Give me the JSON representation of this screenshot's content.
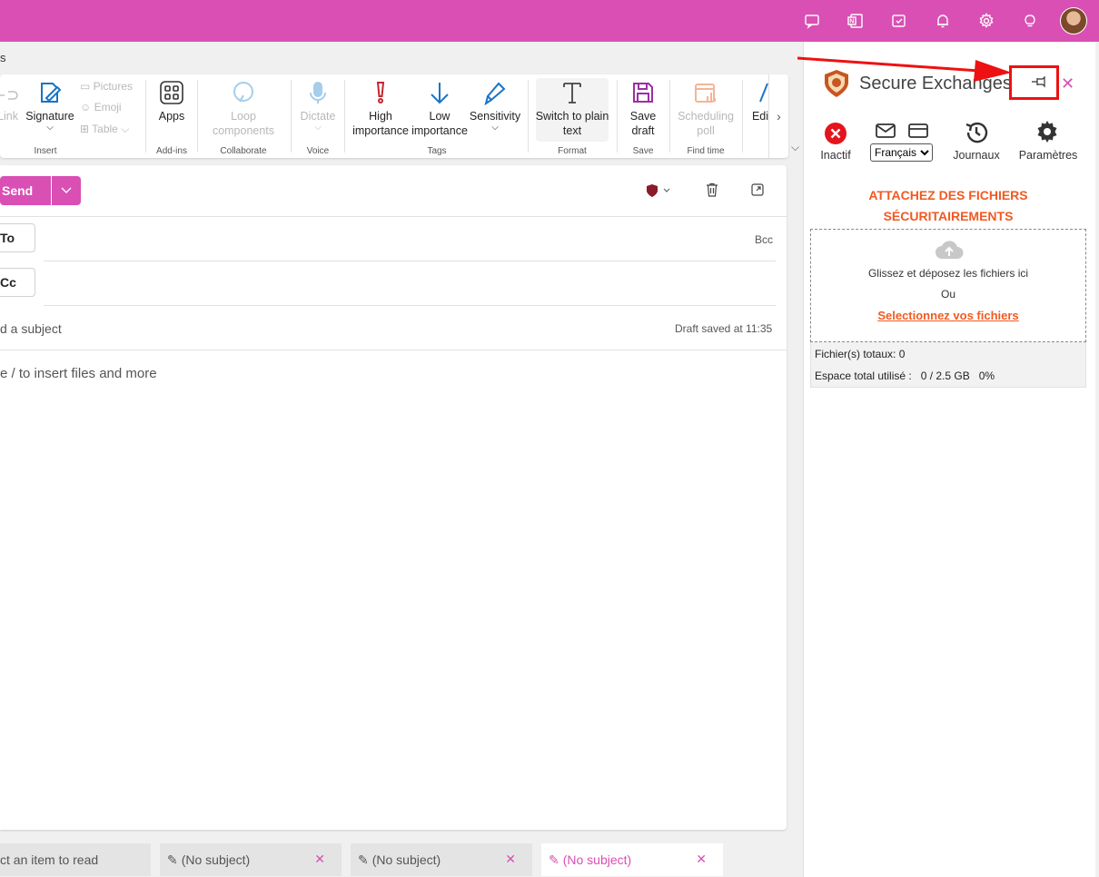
{
  "ribbon": {
    "tab_fragment": "s",
    "link_label": "Link",
    "signature_label": "Signature",
    "pictures_label": "Pictures",
    "emoji_label": "Emoji",
    "table_label": "Table",
    "apps_label": "Apps",
    "loop_line1": "Loop",
    "loop_line2": "components",
    "dictate_label": "Dictate",
    "high_line1": "High",
    "high_line2": "importance",
    "low_line1": "Low",
    "low_line2": "importance",
    "sensitivity_label": "Sensitivity",
    "plain_line1": "Switch to plain",
    "plain_line2": "text",
    "save_line1": "Save",
    "save_line2": "draft",
    "sched_line1": "Scheduling",
    "sched_line2": "poll",
    "edit_label": "Edi",
    "groups": {
      "insert": "Insert",
      "addins": "Add-ins",
      "collaborate": "Collaborate",
      "voice": "Voice",
      "tags": "Tags",
      "format": "Format",
      "save": "Save",
      "findtime": "Find time"
    }
  },
  "compose": {
    "send_label": "Send",
    "to_label": "To",
    "cc_label": "Cc",
    "bcc_label": "Bcc",
    "subject_placeholder": "d a subject",
    "draft_status": "Draft saved at 11:35",
    "body_placeholder": "e / to insert files and more"
  },
  "bottom_tabs": [
    {
      "label": "ct an item to read"
    },
    {
      "label": "(No subject)"
    },
    {
      "label": "(No subject)"
    },
    {
      "label": "(No subject)"
    }
  ],
  "pane": {
    "title": "Secure Exchanges",
    "status_label": "Inactif",
    "language": "Français",
    "journals_label": "Journaux",
    "settings_label": "Paramètres",
    "heading_line1": "ATTACHEZ DES FICHIERS",
    "heading_line2": "SÉCURITAIREMENTS",
    "drop_text": "Glissez et déposez les fichiers ici",
    "or_text": "Ou",
    "select_link": "Selectionnez vos fichiers",
    "total_files": "Fichier(s) totaux: 0",
    "total_space": "Espace total utilisé :   0 / 2.5 GB   0%"
  },
  "colors": {
    "brand": "#d94fb4",
    "orange": "#f05a22",
    "annotation_red": "#ee1111"
  }
}
